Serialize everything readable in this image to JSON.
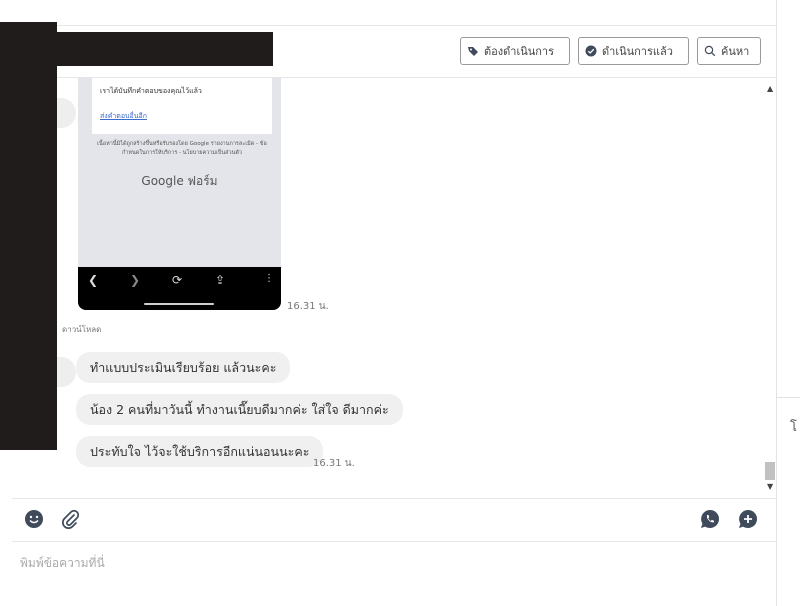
{
  "header": {
    "buttons": [
      {
        "label": "ต้องดำเนินการ",
        "icon": "tag-icon"
      },
      {
        "label": "ดำเนินการแล้ว",
        "icon": "check-circle-icon"
      },
      {
        "label": "ค้นหา",
        "icon": "search-icon"
      }
    ]
  },
  "chat": {
    "image_message": {
      "line1": "เราได้บันทึกคำตอบของคุณไว้แล้ว",
      "link": "ส่งคำตอบอื่นอีก",
      "footer": "เนื้อหานี้มิได้ถูกสร้างขึ้นหรือรับรองโดย Google รายงานการละเมิด - ข้อกำหนดในการให้บริการ - นโยบายความเป็นส่วนตัว",
      "brand": "Google ฟอร์ม",
      "timestamp": "16.31 น."
    },
    "download_label": "ดาวน์โหลด",
    "messages": [
      {
        "text": "ทำแบบประเมินเรียบร้อย แล้วนะคะ"
      },
      {
        "text": "น้อง 2 คนที่มาวันนี้ ทำงานเนี๊ยบดีมากค่ะ ใส่ใจ ดีมากค่ะ"
      },
      {
        "text": "ประทับใจ ไว้จะใช้บริการอีกแน่นอนนะคะ",
        "timestamp": "16.31 น."
      }
    ]
  },
  "toolbar": {
    "left_icons": [
      "emoji-icon",
      "attachment-icon"
    ],
    "right_icons": [
      "phone-icon",
      "add-message-icon"
    ]
  },
  "composer": {
    "placeholder": "พิมพ์ข้อความที่นี่"
  },
  "right_panel": {
    "glyph": "โ"
  },
  "colors": {
    "accent_icon": "#3f4a5a",
    "bubble_bg": "#f0f0f1",
    "redaction": "#201c1c"
  }
}
